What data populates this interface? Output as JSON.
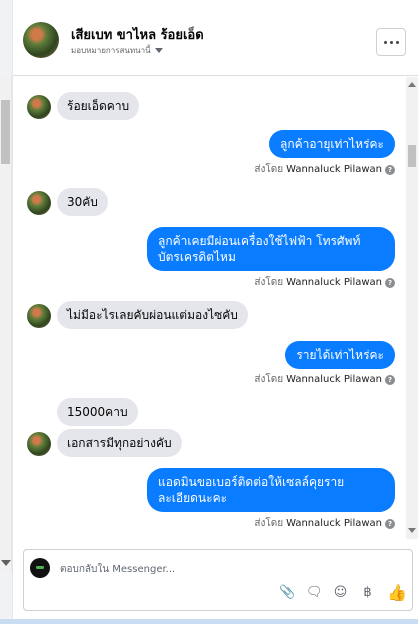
{
  "header": {
    "name": "เสียเบท ขาไหล ร้อยเอ็ด",
    "assign_label": "มอบหมายการสนทนานี้",
    "more_label": "•••"
  },
  "messages": [
    {
      "dir": "in",
      "text": "ร้อยเอ็ดคาบ",
      "avatar": true
    },
    {
      "dir": "out",
      "text": "ลูกค้าอายุเท่าไหร่คะ"
    },
    {
      "dir": "in",
      "text": "30คับ",
      "avatar": true
    },
    {
      "dir": "out",
      "text": "ลูกค้าเคยมีผ่อนเครื่องใช้ไฟฟ้า โทรศัพท์ บัตรเครดิตไหม"
    },
    {
      "dir": "in",
      "text": "ไม่มีอะไรเลยคับผ่อนแต่มองไซคับ",
      "avatar": true
    },
    {
      "dir": "out",
      "text": "รายได้เท่าไหร่คะ"
    },
    {
      "dir": "in",
      "text": "15000คาบ",
      "avatar": false
    },
    {
      "dir": "in",
      "text": "เอกสารมีทุกอย่างคับ",
      "avatar": true
    },
    {
      "dir": "out",
      "text": "แอดมินขอเบอร์ติดต่อให้เซลล์คุยรายละเอียดนะคะ"
    }
  ],
  "sent_by": {
    "prefix": "ส่งโดย",
    "name": "Wannaluck Pilawan",
    "info_icon": "?"
  },
  "composer": {
    "placeholder": "ตอบกลับใน Messenger...",
    "icons": [
      "attachment-icon",
      "saved-reply-icon",
      "emoji-icon",
      "payment-icon",
      "like-icon"
    ],
    "payment_symbol": "฿"
  }
}
